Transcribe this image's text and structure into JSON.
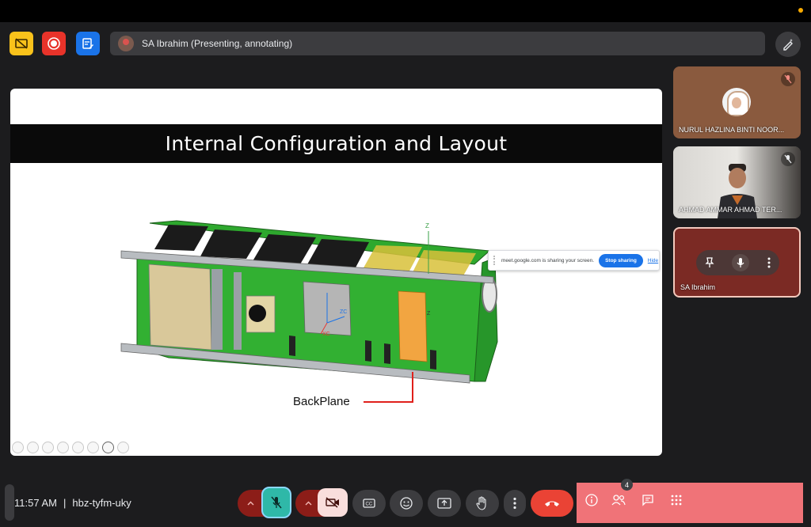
{
  "presenter_bar": {
    "text": "SA Ibrahim (Presenting, annotating)"
  },
  "slide": {
    "title": "Internal Configuration and Layout",
    "annotation_label": "BackPlane",
    "axis_labels": {
      "z_top": "Z",
      "zc": "ZC",
      "xc": "XC",
      "z_right": "Z"
    }
  },
  "share_banner": {
    "text": "meet.google.com is sharing your screen.",
    "stop_label": "Stop sharing",
    "hide_label": "Hide"
  },
  "participants": [
    {
      "name": "NURUL HAZLINA BINTI NOOR...",
      "muted": true
    },
    {
      "name": "AHMAD AMMAR AHMAD TER...",
      "muted": true
    },
    {
      "name": "SA Ibrahim",
      "muted": false
    }
  ],
  "meeting": {
    "time": "11:57 AM",
    "separator": "|",
    "code": "hbz-tyfm-uky"
  },
  "people_count": "4",
  "colors": {
    "record": "#e8332a",
    "captions": "#f9c21b",
    "whiteboard": "#1a73e8",
    "mic_active": "#2fb8a8",
    "leave": "#ea4335",
    "right_panel": "#f07378"
  }
}
